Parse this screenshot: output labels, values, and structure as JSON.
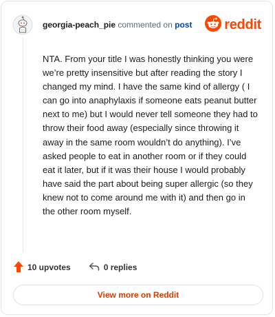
{
  "header": {
    "username": "georgia-peach_pie",
    "action_text": "commented on",
    "post_link": "post",
    "brand_name": "reddit",
    "avatar_icon": "snoo-avatar-icon",
    "brand_icon": "reddit-logo-icon"
  },
  "comment": {
    "body": "NTA. From your title I was honestly thinking you were we’re pretty insensitive but after reading the story I changed my mind. I have the same kind of allergy ( I can go into anaphylaxis if someone eats peanut butter next to me) but I would never tell someone they had to throw their food away (especially since throwing it away in the same room wouldn’t do anything). I’ve asked people to eat in another room or if they could eat it later, but if it was their house I would probably have said the part about being super allergic (so they knew not to come around me with it) and then go in the other room myself."
  },
  "actions": {
    "upvotes": "10 upvotes",
    "replies": "0 replies",
    "upvote_icon": "upvote-arrow-icon",
    "reply_icon": "reply-icon"
  },
  "footer": {
    "view_more": "View more on Reddit"
  },
  "colors": {
    "brand": "#ff4500",
    "link": "#0045ac",
    "button_text": "#d93a00"
  }
}
